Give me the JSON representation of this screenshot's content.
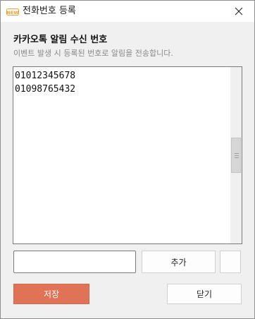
{
  "window": {
    "title": "전화번호 등록",
    "icon": "new-badge-icon",
    "close_icon": "close-icon"
  },
  "header": {
    "heading": "카카오톡 알림 수신 번호",
    "description": "이벤트 발생 시 등록된 번호로 알림을 전송합니다."
  },
  "phone_list": {
    "items": [
      "01012345678",
      "01098765432"
    ]
  },
  "input": {
    "value": "",
    "placeholder": ""
  },
  "buttons": {
    "add_label": "추가",
    "delete_label": "",
    "save_label": "저장",
    "close_label": "닫기"
  },
  "colors": {
    "accent": "#e07356",
    "window_bg": "#f0f0f0",
    "subtext": "#8a8a8a",
    "icon_orange": "#e8a23a"
  }
}
